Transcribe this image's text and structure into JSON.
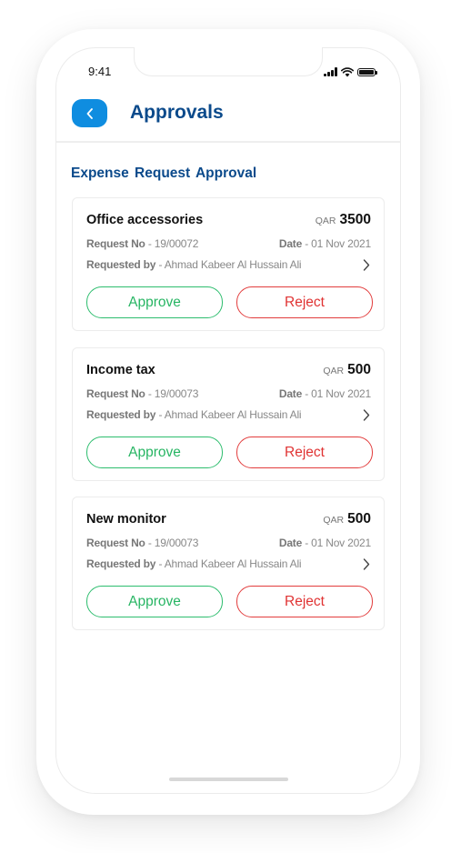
{
  "status_bar": {
    "time": "9:41"
  },
  "header": {
    "back_icon": "chevron-left-icon",
    "title": "Approvals"
  },
  "section": {
    "title": "Expense Request Approval"
  },
  "requests": [
    {
      "title": "Office accessories",
      "currency": "QAR",
      "amount": "3500",
      "request_no_label": "Request No",
      "request_no": "- 19/00072",
      "date_label": "Date",
      "date": "- 01 Nov 2021",
      "requested_by_label": "Requested by",
      "requested_by": "- Ahmad Kabeer Al Hussain Ali",
      "approve_label": "Approve",
      "reject_label": "Reject"
    },
    {
      "title": "Income tax",
      "currency": "QAR",
      "amount": "500",
      "request_no_label": "Request No",
      "request_no": "- 19/00073",
      "date_label": "Date",
      "date": "- 01 Nov 2021",
      "requested_by_label": "Requested by",
      "requested_by": "- Ahmad Kabeer Al Hussain Ali",
      "approve_label": "Approve",
      "reject_label": "Reject"
    },
    {
      "title": "New monitor",
      "currency": "QAR",
      "amount": "500",
      "request_no_label": "Request No",
      "request_no": "- 19/00073",
      "date_label": "Date",
      "date": "- 01 Nov 2021",
      "requested_by_label": "Requested by",
      "requested_by": "- Ahmad Kabeer Al Hussain Ali",
      "approve_label": "Approve",
      "reject_label": "Reject"
    }
  ],
  "colors": {
    "accent": "#0f8de0",
    "title": "#0b4a8b",
    "approve": "#27b563",
    "reject": "#e03333"
  }
}
